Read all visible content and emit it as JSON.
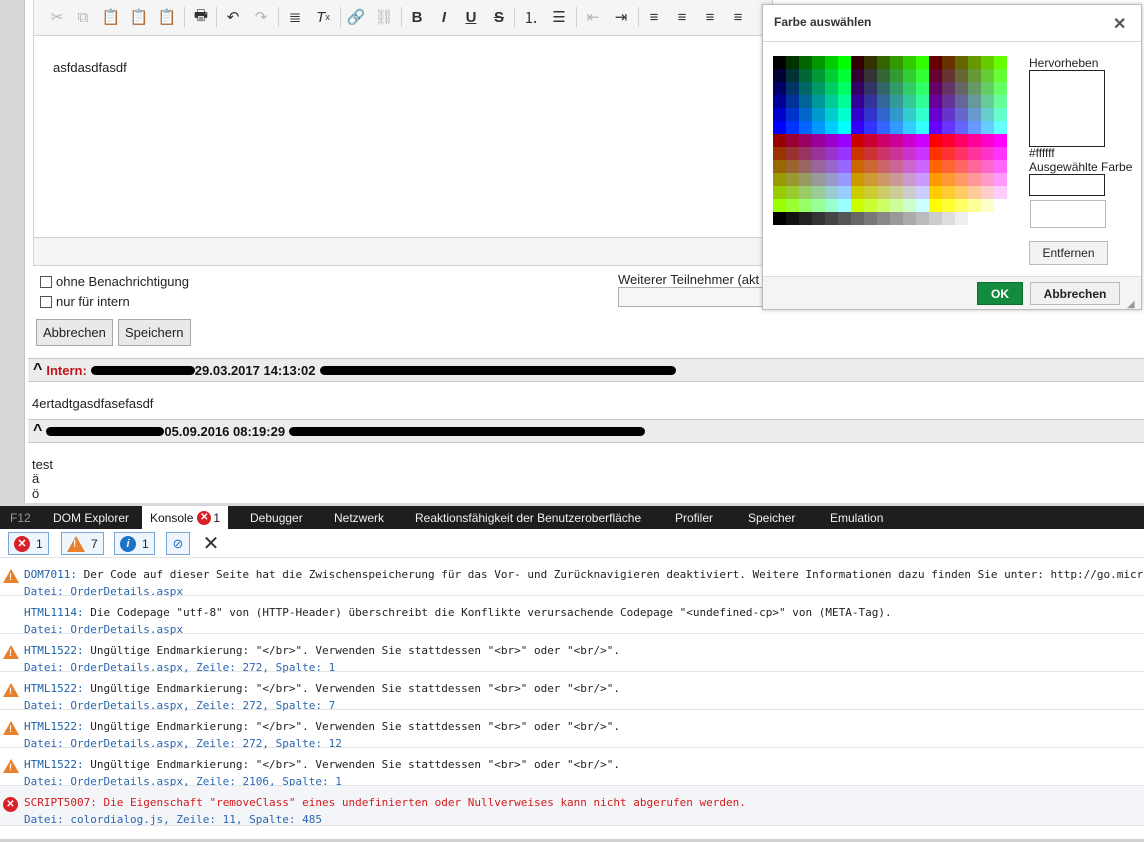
{
  "editor": {
    "content": "asfdasdfasdf",
    "toolbar_icons": [
      "cut-icon",
      "copy-icon",
      "paste-icon",
      "paste-text-icon",
      "paste-word-icon",
      "print-icon",
      "undo-icon",
      "redo-icon",
      "format-icon",
      "remove-format-icon",
      "link-icon",
      "unlink-icon",
      "bold-icon",
      "italic-icon",
      "underline-icon",
      "strikethrough-icon",
      "numbered-list-icon",
      "bullet-list-icon",
      "outdent-icon",
      "indent-icon",
      "align-left-icon",
      "align-center-icon",
      "align-right-icon",
      "align-justify-icon"
    ]
  },
  "form": {
    "checkbox_no_notify": "ohne Benachrichtigung",
    "checkbox_internal": "nur für intern",
    "weiterer_label": "Weiterer Teilnehmer (akt",
    "cancel_button": "Abbrechen",
    "save_button": "Speichern"
  },
  "entries": [
    {
      "intern_label": "Intern:",
      "timestamp": "29.03.2017 14:13:02",
      "text": "4ertadtgasdfasefasdf"
    },
    {
      "timestamp": "05.09.2016 08:19:29",
      "lines": [
        "test",
        "ä",
        "ö"
      ]
    }
  ],
  "color_dialog": {
    "title": "Farbe auswählen",
    "highlight_label": "Hervorheben",
    "highlight_value": "#ffffff",
    "selected_label": "Ausgewählte Farbe",
    "remove_button": "Entfernen",
    "ok_button": "OK",
    "cancel_button": "Abbrechen"
  },
  "devtools": {
    "tabs": [
      "F12",
      "DOM Explorer",
      "Konsole",
      "Debugger",
      "Netzwerk",
      "Reaktionsfähigkeit der Benutzeroberfläche",
      "Profiler",
      "Speicher",
      "Emulation"
    ],
    "active_tab": "Konsole",
    "console_error_badge": "1",
    "filter_errors": "1",
    "filter_warnings": "7",
    "filter_info": "1",
    "messages": [
      {
        "level": "warning",
        "code": "DOM7011:",
        "text": " Der Code auf dieser Seite hat die Zwischenspeicherung für das Vor- und Zurücknavigieren deaktiviert. Weitere Informationen dazu finden Sie unter: http://go.micro",
        "file": "Datei: OrderDetails.aspx"
      },
      {
        "level": "info",
        "code": "HTML1114:",
        "text": " Die Codepage \"utf-8\" von (HTTP-Header) überschreibt die Konflikte verursachende Codepage \"<undefined-cp>\" von (META-Tag).",
        "file": "Datei: OrderDetails.aspx"
      },
      {
        "level": "warning",
        "code": "HTML1522:",
        "text": " Ungültige Endmarkierung: \"</br>\". Verwenden Sie stattdessen \"<br>\" oder \"<br/>\".",
        "file": "Datei: OrderDetails.aspx, Zeile: 272, Spalte: 1"
      },
      {
        "level": "warning",
        "code": "HTML1522:",
        "text": " Ungültige Endmarkierung: \"</br>\". Verwenden Sie stattdessen \"<br>\" oder \"<br/>\".",
        "file": "Datei: OrderDetails.aspx, Zeile: 272, Spalte: 7"
      },
      {
        "level": "warning",
        "code": "HTML1522:",
        "text": " Ungültige Endmarkierung: \"</br>\". Verwenden Sie stattdessen \"<br>\" oder \"<br/>\".",
        "file": "Datei: OrderDetails.aspx, Zeile: 272, Spalte: 12"
      },
      {
        "level": "warning",
        "code": "HTML1522:",
        "text": " Ungültige Endmarkierung: \"</br>\". Verwenden Sie stattdessen \"<br>\" oder \"<br/>\".",
        "file": "Datei: OrderDetails.aspx, Zeile: 2106, Spalte: 1"
      },
      {
        "level": "error",
        "code": "SCRIPT5007:",
        "text": " Die Eigenschaft \"removeClass\" eines undefinierten oder Nullverweises kann nicht abgerufen werden.",
        "file": "Datei: colordialog.js, Zeile: 11, Spalte: 485"
      }
    ]
  }
}
